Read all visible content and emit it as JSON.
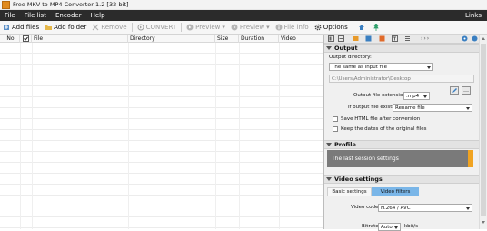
{
  "window": {
    "title": "Free MKV to MP4 Converter 1.2  [32-bit]"
  },
  "menu": {
    "items": [
      "File",
      "File list",
      "Encoder",
      "Help"
    ],
    "right": "Links"
  },
  "toolbar": {
    "add_files": "Add files",
    "add_folder": "Add folder",
    "remove": "Remove",
    "convert": "CONVERT",
    "preview": "Preview",
    "preview2": "Preview",
    "file_info": "File info",
    "options": "Options"
  },
  "grid": {
    "columns": [
      "No",
      "",
      "File",
      "Directory",
      "Size",
      "Duration",
      "Video"
    ]
  },
  "panel": {
    "arrows": "›››",
    "output": {
      "header": "Output",
      "dir_label": "Output directory:",
      "dir_value": "The same as input file",
      "path": "C:\\Users\\Administrator\\Desktop",
      "ext_label": "Output file extension:",
      "ext_value": ".mp4",
      "exists_label": "If output file exists:",
      "exists_value": "Rename file",
      "save_html": "Save HTML file after conversion",
      "keep_dates": "Keep the dates of the original files"
    },
    "profile": {
      "header": "Profile",
      "value": "The last session settings"
    },
    "video": {
      "header": "Video settings",
      "tab_basic": "Basic settings",
      "tab_filters": "Video filters",
      "codec_label": "Video codec:",
      "codec_value": "H.264 / AVC",
      "bitrate_label": "Bitrate:",
      "bitrate_value": "Auto",
      "bitrate_unit": "kbit/s"
    }
  },
  "colors": {
    "menubar": "#2b2b2b",
    "accent_orange": "#f0a321",
    "tab_active": "#7ab6e8"
  }
}
